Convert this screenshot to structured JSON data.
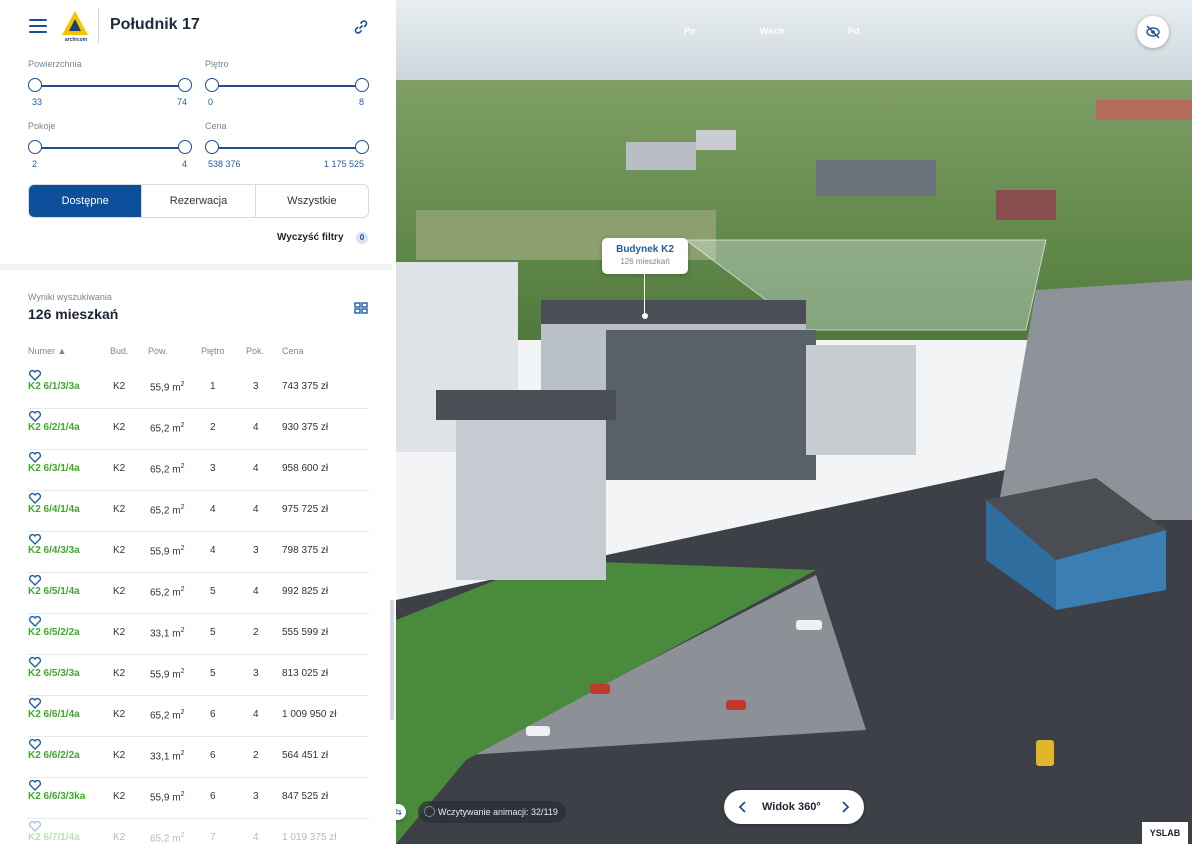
{
  "header": {
    "project_title": "Południk 17",
    "logo_text": "archicom"
  },
  "filters": {
    "area": {
      "label": "Powierzchnia",
      "min": "33",
      "max": "74"
    },
    "floor": {
      "label": "Piętro",
      "min": "0",
      "max": "8"
    },
    "rooms": {
      "label": "Pokoje",
      "min": "2",
      "max": "4"
    },
    "price": {
      "label": "Cena",
      "min": "538 376",
      "max": "1 175 525"
    },
    "tabs": [
      "Dostępne",
      "Rezerwacja",
      "Wszystkie"
    ],
    "active_tab": "Dostępne",
    "clear_label": "Wyczyść filtry",
    "clear_count": "0"
  },
  "results": {
    "label": "Wyniki wyszukiwania",
    "count": "126 mieszkań",
    "columns": [
      "Numer ▲",
      "Bud.",
      "Pow.",
      "Piętro",
      "Pok.",
      "Cena"
    ],
    "rows": [
      {
        "num": "K2 6/1/3/3a",
        "bud": "K2",
        "pow": "55,9 m",
        "pie": "1",
        "pok": "3",
        "price": "743 375 zł"
      },
      {
        "num": "K2 6/2/1/4a",
        "bud": "K2",
        "pow": "65,2 m",
        "pie": "2",
        "pok": "4",
        "price": "930 375 zł"
      },
      {
        "num": "K2 6/3/1/4a",
        "bud": "K2",
        "pow": "65,2 m",
        "pie": "3",
        "pok": "4",
        "price": "958 600 zł"
      },
      {
        "num": "K2 6/4/1/4a",
        "bud": "K2",
        "pow": "65,2 m",
        "pie": "4",
        "pok": "4",
        "price": "975 725 zł"
      },
      {
        "num": "K2 6/4/3/3a",
        "bud": "K2",
        "pow": "55,9 m",
        "pie": "4",
        "pok": "3",
        "price": "798 375 zł"
      },
      {
        "num": "K2 6/5/1/4a",
        "bud": "K2",
        "pow": "65,2 m",
        "pie": "5",
        "pok": "4",
        "price": "992 825 zł"
      },
      {
        "num": "K2 6/5/2/2a",
        "bud": "K2",
        "pow": "33,1 m",
        "pie": "5",
        "pok": "2",
        "price": "555 599 zł"
      },
      {
        "num": "K2 6/5/3/3a",
        "bud": "K2",
        "pow": "55,9 m",
        "pie": "5",
        "pok": "3",
        "price": "813 025 zł"
      },
      {
        "num": "K2 6/6/1/4a",
        "bud": "K2",
        "pow": "65,2 m",
        "pie": "6",
        "pok": "4",
        "price": "1 009 950 zł"
      },
      {
        "num": "K2 6/6/2/2a",
        "bud": "K2",
        "pow": "33,1 m",
        "pie": "6",
        "pok": "2",
        "price": "564 451 zł"
      },
      {
        "num": "K2 6/6/3/3ka",
        "bud": "K2",
        "pow": "55,9 m",
        "pie": "6",
        "pok": "3",
        "price": "847 525 zł"
      },
      {
        "num": "K2 6/7/1/4a",
        "bud": "K2",
        "pow": "65,2 m",
        "pie": "7",
        "pok": "4",
        "price": "1 019 375 zł"
      }
    ]
  },
  "scene": {
    "compass": {
      "left": "Pn",
      "center": "Wsch",
      "right": "Pd"
    },
    "callout": {
      "building": "Budynek K2",
      "units": "126 mieszkań"
    },
    "loading_text": "Wczytywanie animacji: 32/119",
    "view_label": "Widok 360°",
    "brand": "YSLAB"
  },
  "colors": {
    "accent": "#0e4f9b",
    "unit_number": "#3eaa2b"
  }
}
